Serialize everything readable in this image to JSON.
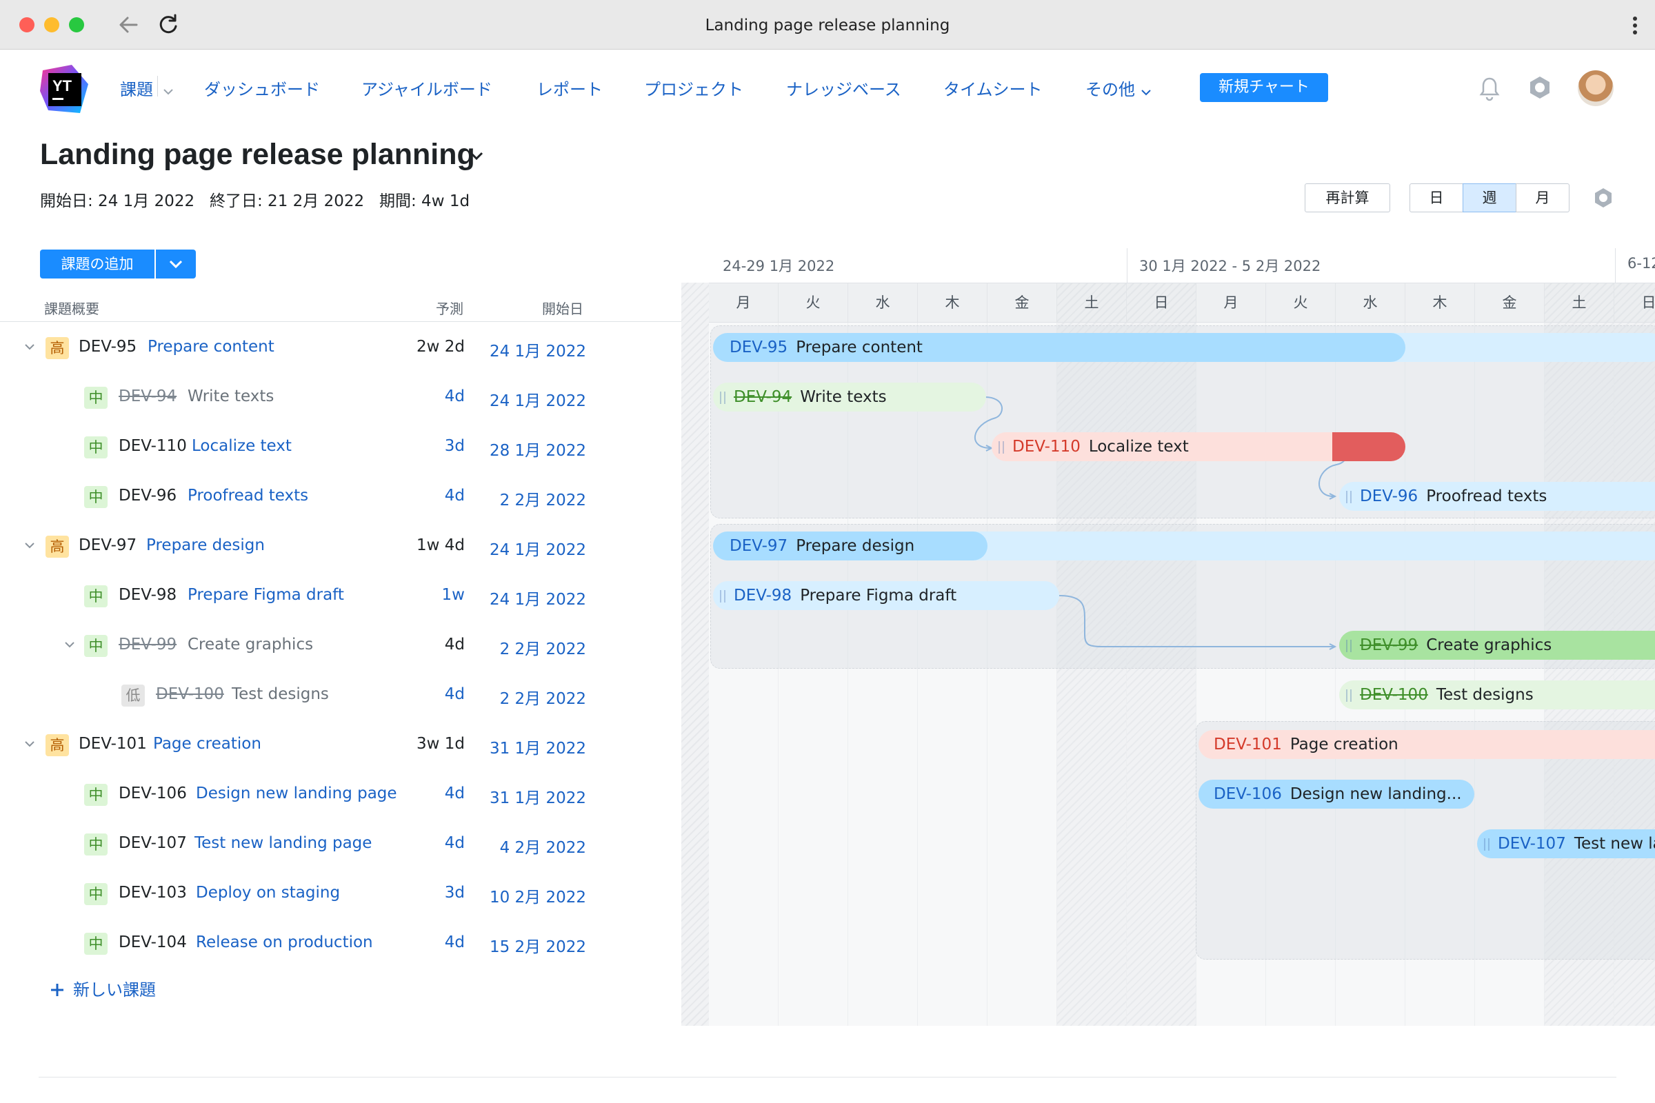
{
  "window": {
    "title": "Landing page release planning"
  },
  "header": {
    "menu": [
      "課題",
      "ダッシュボード",
      "アジャイルボード",
      "レポート",
      "プロジェクト",
      "ナレッジベース",
      "タイムシート",
      "その他"
    ],
    "new_chart_label": "新規チャート"
  },
  "page": {
    "title": "Landing page release planning",
    "start": "開始日: 24 1月 2022",
    "end": "終了日: 21 2月 2022",
    "duration": "期間: 4w 1d",
    "recalc_label": "再計算",
    "scale": [
      "日",
      "週",
      "月"
    ],
    "scale_selected": "週"
  },
  "list": {
    "add_issue_label": "課題の追加",
    "columns": [
      "課題概要",
      "予測",
      "開始日"
    ],
    "new_issue_label": "新しい課題",
    "rows": [
      {
        "key": "DEV-95",
        "summary": "Prepare content",
        "priority": "高",
        "estimate": "2w 2d",
        "start": "24 1月 2022"
      },
      {
        "key": "DEV-94",
        "summary": "Write texts",
        "priority": "中",
        "estimate": "4d",
        "start": "24 1月 2022"
      },
      {
        "key": "DEV-110",
        "summary": "Localize text",
        "priority": "中",
        "estimate": "3d",
        "start": "28 1月 2022"
      },
      {
        "key": "DEV-96",
        "summary": "Proofread texts",
        "priority": "中",
        "estimate": "4d",
        "start": "2 2月 2022"
      },
      {
        "key": "DEV-97",
        "summary": "Prepare design",
        "priority": "高",
        "estimate": "1w 4d",
        "start": "24 1月 2022"
      },
      {
        "key": "DEV-98",
        "summary": "Prepare Figma draft",
        "priority": "中",
        "estimate": "1w",
        "start": "24 1月 2022"
      },
      {
        "key": "DEV-99",
        "summary": "Create graphics",
        "priority": "中",
        "estimate": "4d",
        "start": "2 2月 2022"
      },
      {
        "key": "DEV-100",
        "summary": "Test designs",
        "priority": "低",
        "estimate": "4d",
        "start": "2 2月 2022"
      },
      {
        "key": "DEV-101",
        "summary": "Page creation",
        "priority": "高",
        "estimate": "3w 1d",
        "start": "31 1月 2022"
      },
      {
        "key": "DEV-106",
        "summary": "Design new landing page",
        "priority": "中",
        "estimate": "4d",
        "start": "31 1月 2022"
      },
      {
        "key": "DEV-107",
        "summary": "Test new landing page",
        "priority": "中",
        "estimate": "4d",
        "start": "4 2月 2022"
      },
      {
        "key": "DEV-103",
        "summary": "Deploy on staging",
        "priority": "中",
        "estimate": "3d",
        "start": "10 2月 2022"
      },
      {
        "key": "DEV-104",
        "summary": "Release on production",
        "priority": "中",
        "estimate": "4d",
        "start": "15 2月 2022"
      }
    ]
  },
  "gantt": {
    "weeks": [
      "24-29 1月 2022",
      "30 1月 2022 - 5 2月 2022",
      "6-12"
    ],
    "days": [
      "月",
      "火",
      "水",
      "木",
      "金",
      "土",
      "日",
      "月",
      "火",
      "水",
      "木",
      "金",
      "土",
      "日"
    ],
    "bars": [
      {
        "key": "DEV-95",
        "summary": "Prepare content"
      },
      {
        "key": "DEV-94",
        "summary": "Write texts"
      },
      {
        "key": "DEV-110",
        "summary": "Localize text"
      },
      {
        "key": "DEV-96",
        "summary": "Proofread texts"
      },
      {
        "key": "DEV-97",
        "summary": "Prepare design"
      },
      {
        "key": "DEV-98",
        "summary": "Prepare Figma draft"
      },
      {
        "key": "DEV-99",
        "summary": "Create graphics"
      },
      {
        "key": "DEV-100",
        "summary": "Test designs"
      },
      {
        "key": "DEV-101",
        "summary": "Page creation"
      },
      {
        "key": "DEV-106",
        "summary": "Design new landing..."
      },
      {
        "key": "DEV-107",
        "summary": "Test new la"
      }
    ]
  }
}
